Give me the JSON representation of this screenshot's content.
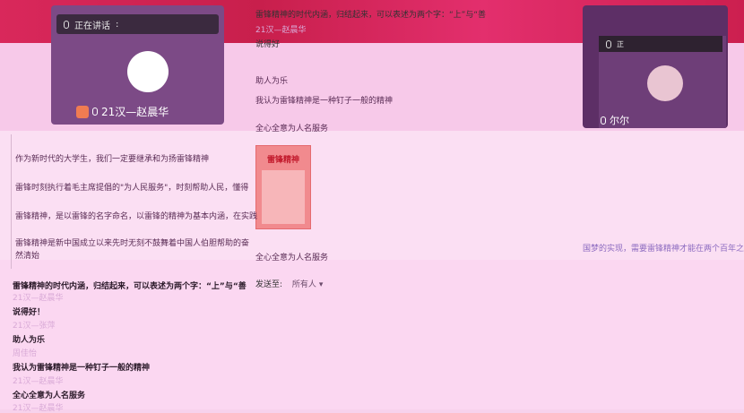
{
  "tiles": {
    "left": {
      "status": "正在讲话",
      "name": "21汉—赵晨华"
    },
    "right": {
      "status_prefix": "正",
      "name": "尔尔"
    }
  },
  "center_chat": {
    "intro": "雷锋精神的时代内涵，归结起来，可以表述为两个字：“上”与“善",
    "lines": [
      {
        "text": "21汉—赵晨华",
        "style": "msg-faded"
      },
      {
        "text": "说得好",
        "style": "msg-bold"
      },
      {
        "text": "助人为乐",
        "style": "msg-text"
      },
      {
        "text": "我认为雷锋精神是一种钉子一般的精神",
        "style": "msg-text"
      },
      {
        "text": "全心全意为人名服务",
        "style": "msg-text"
      },
      {
        "text": "全心全意为人名服务",
        "style": "msg-text"
      }
    ],
    "poster_title": "雷锋精神",
    "send_label": "发送至:",
    "send_target": "所有人"
  },
  "left_chat": {
    "lines": [
      "作为新时代的大学生，我们一定要继承和为扬雷锋精神",
      "雷锋时刻执行着毛主席提倡的\"为人民服务\"，时刻帮助人民，懂得",
      "雷锋精神，是以雷锋的名字命名，以雷锋的精神为基本内涵，在实践",
      "雷锋精神是新中国成立以来先时无刻不鼓舞着中国人伯胆帮助的奋",
      "然清始"
    ]
  },
  "bottom_chat": {
    "lines": [
      {
        "text": "雷锋精神的时代内涵，归结起来，可以表述为两个字：“上”与“善",
        "style": "msg-bold"
      },
      {
        "text": "21汉—赵晨华",
        "style": "msg-faded"
      },
      {
        "text": "说得好！",
        "style": "msg-bold"
      },
      {
        "text": "21汉—张萍",
        "style": "msg-faded"
      },
      {
        "text": "助人为乐",
        "style": "msg-bold"
      },
      {
        "text": "周佳怡",
        "style": "msg-faded"
      },
      {
        "text": "我认为雷锋精神是一种钉子一般的精神",
        "style": "msg-bold"
      },
      {
        "text": "21汉—赵晨华",
        "style": "msg-faded"
      },
      {
        "text": "全心全意为人名服务",
        "style": "msg-bold"
      },
      {
        "text": "21汉—赵晨华",
        "style": "msg-faded"
      }
    ]
  },
  "right_hint": "国梦的实现，需要雷锋精神才能在两个百年之",
  "colors": {
    "topbar": "#d9285b",
    "tile": "#7c4a86",
    "accent_pink": "#f7d2ec"
  }
}
